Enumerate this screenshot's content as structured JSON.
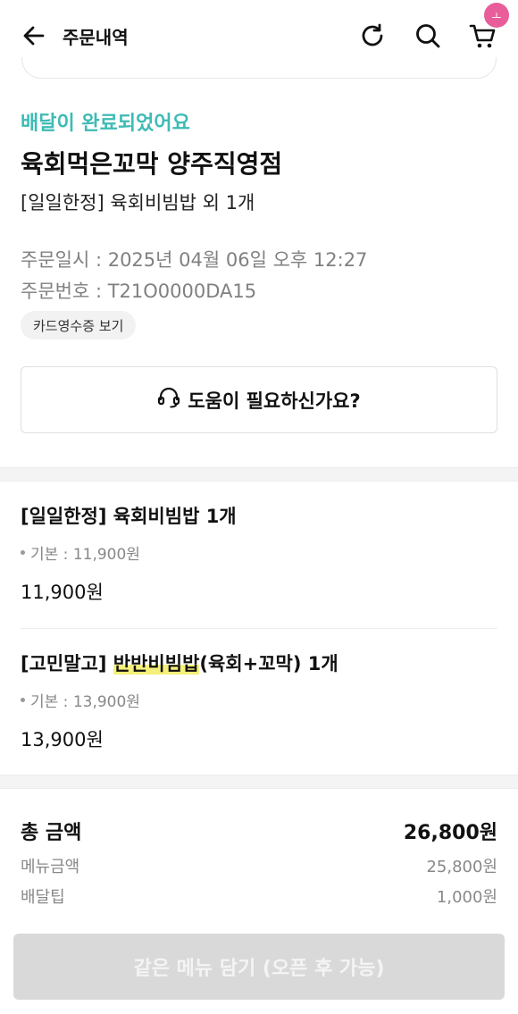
{
  "header": {
    "title": "주문내역",
    "cart_badge": "ㅗ"
  },
  "order": {
    "status": "배달이 완료되었어요",
    "store_name": "육회먹은꼬막 양주직영점",
    "summary": "[일일한정] 육회비빔밥 외 1개",
    "order_datetime": "주문일시 : 2025년 04월 06일 오후 12:27",
    "order_number": "주문번호 : T21O0000DA15",
    "receipt_label": "카드영수증 보기",
    "help_label": "도움이 필요하신가요?"
  },
  "items": [
    {
      "name_prefix": "[일일한정] 육회비빔밥 1개",
      "name_highlight": "",
      "name_suffix": "",
      "option": "기본 : 11,900원",
      "price": "11,900원"
    },
    {
      "name_prefix": "[고민말고] ",
      "name_highlight": "반반비빔밥",
      "name_suffix": "(육회+꼬막) 1개",
      "option": "기본 : 13,900원",
      "price": "13,900원"
    }
  ],
  "totals": {
    "total_label": "총 금액",
    "total_value": "26,800원",
    "menu_label": "메뉴금액",
    "menu_value": "25,800원",
    "tip_label": "배달팁",
    "tip_value": "1,000원"
  },
  "cta_label": "같은 메뉴 담기 (오픈 후 가능)",
  "colors": {
    "status": "#3dbbb5",
    "badge": "#e85d9a",
    "highlight": "#f5f07a",
    "cta_disabled": "#d9d9d9"
  }
}
